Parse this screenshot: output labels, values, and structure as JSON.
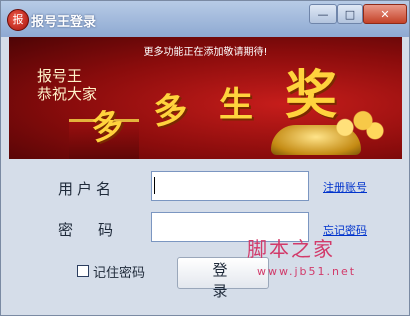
{
  "window": {
    "title": "报号王登录",
    "app_icon": "报"
  },
  "controls": {
    "minimize": "—",
    "maximize": "□",
    "close": "✕"
  },
  "banner": {
    "notice": "更多功能正在添加敬请期待!",
    "line1": "报号王",
    "line2": "恭祝大家",
    "big_1": "多",
    "big_2": "多",
    "big_3": "生",
    "big_4": "奖"
  },
  "form": {
    "username_label": "用户名",
    "password_label": "密码",
    "username_value": "",
    "password_value": "",
    "register_link": "注册账号",
    "forgot_link": "忘记密码",
    "remember_label": "记住密码",
    "login_button": "登录"
  },
  "watermark": {
    "text": "脚本之家",
    "url": "www.jb51.net"
  },
  "colors": {
    "title_bar": "#8ea9d2",
    "banner_red": "#8a0c0c",
    "gold": "#ffd33d",
    "link": "#0033cc"
  }
}
